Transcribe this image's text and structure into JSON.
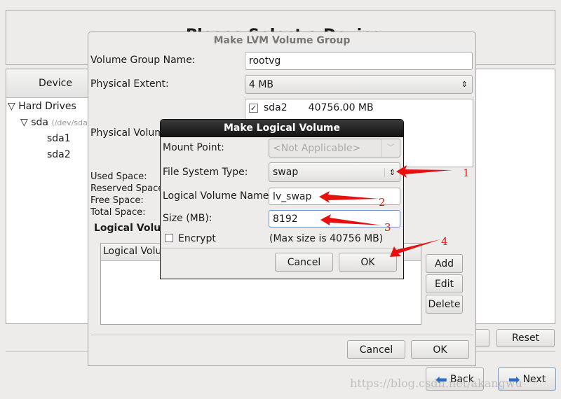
{
  "background": {
    "title": "Please Select a Device",
    "device_header": "Device",
    "tree": {
      "root": "Hard Drives",
      "disk": "sda",
      "disk_path": "(/dev/sda)",
      "partitions": [
        "sda1",
        "sda2"
      ]
    },
    "reset_label": "Reset",
    "back_label": "Back",
    "next_label": "Next"
  },
  "lvm_dialog": {
    "title": "Make LVM Volume Group",
    "vg_name_label": "Volume Group Name:",
    "vg_name_value": "rootvg",
    "pe_label": "Physical Extent:",
    "pe_value": "4 MB",
    "pv_label": "Physical Volumes to Use:",
    "pvs": [
      {
        "name": "sda2",
        "size": "40756.00 MB",
        "checked": true
      }
    ],
    "used_label": "Used Space:",
    "reserved_label": "Reserved Space:",
    "free_label": "Free Space:",
    "total_label": "Total Space:",
    "lv_section": "Logical Volumes",
    "lv_col": "Logical Volume Name",
    "add_label": "Add",
    "edit_label": "Edit",
    "delete_label": "Delete",
    "cancel_label": "Cancel",
    "ok_label": "OK"
  },
  "lv_dialog": {
    "title": "Make Logical Volume",
    "mount_label": "Mount Point:",
    "mount_value": "<Not Applicable>",
    "fs_label": "File System Type:",
    "fs_value": "swap",
    "name_label": "Logical Volume Name:",
    "name_value": "lv_swap",
    "size_label": "Size (MB):",
    "size_value": "8192",
    "encrypt_label": "Encrypt",
    "encrypt_checked": false,
    "max_size": "(Max size is 40756 MB)",
    "cancel_label": "Cancel",
    "ok_label": "OK"
  },
  "annotations": {
    "color": "#e8100f",
    "numbers": [
      "1",
      "2",
      "3",
      "4"
    ]
  },
  "watermark": "https://blog.csdn.net/akangwu"
}
